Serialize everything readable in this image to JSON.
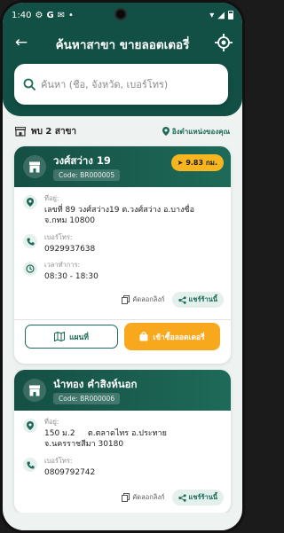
{
  "status_bar": {
    "time": "1:40"
  },
  "header": {
    "title": "ค้นหาสาขา ขายลอตเตอรี่",
    "search_placeholder": "ค้นหา (ชื่อ, จังหวัด, เบอร์โทร)"
  },
  "results": {
    "count_text": "พบ 2 สาขา",
    "sort_label": "อิงตำแหน่งของคุณ"
  },
  "labels": {
    "address": "ที่อยู่:",
    "phone": "เบอร์โทร:",
    "hours": "เวลาทำการ:",
    "copy_link": "คัดลอกลิงก์",
    "share": "แชร์ร้านนี้",
    "map": "แผนที่",
    "buy": "เข้าซื้อลอตเตอรี่"
  },
  "branches": [
    {
      "name": "วงศ์สว่าง 19",
      "code": "Code: BR000005",
      "distance": "9.83 กม.",
      "address": "เลขที่ 89 วงศ์สว่าง19 ต.วงศ์สว่าง อ.บางซื่อ จ.กทม 10800",
      "phone": "0929937638",
      "hours": "08:30 - 18:30"
    },
    {
      "name": "นำทอง คำสิงห์นอก",
      "code": "Code: BR000006",
      "address": "150 ม.2     ต.ตลาดไทร อ.ประทาย จ.นครราชสีมา 30180",
      "phone": "0809792742"
    }
  ],
  "colors": {
    "primary": "#124f44",
    "accent_orange": "#f8a81c",
    "badge_yellow": "#f7b51f",
    "background": "#eef3f1"
  }
}
